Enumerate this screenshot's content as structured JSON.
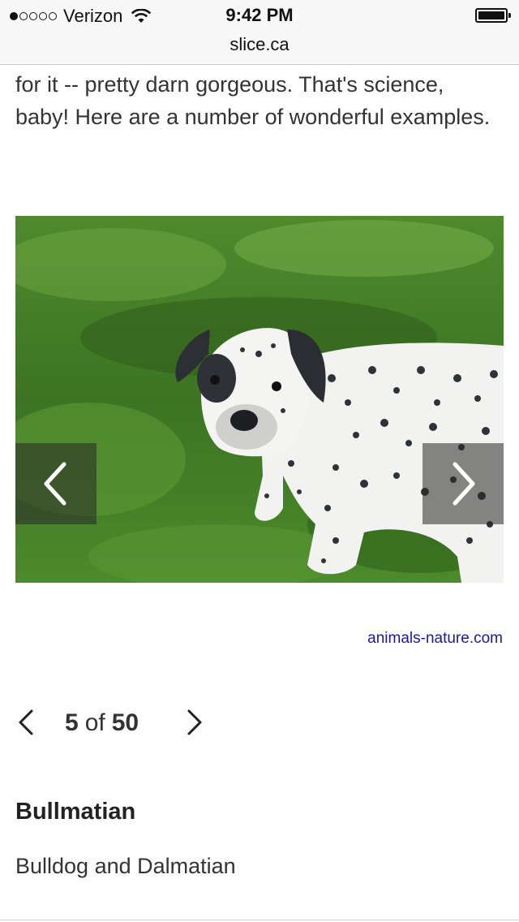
{
  "status_bar": {
    "carrier": "Verizon",
    "time": "9:42 PM",
    "signal_bars": 1,
    "battery_level": 1.0
  },
  "browser": {
    "url": "slice.ca"
  },
  "article": {
    "intro_text": "for it -- pretty darn gorgeous. That's science, baby! Here are a number of wonderful examples."
  },
  "gallery": {
    "image_icon": "spotted-puppy-photo",
    "prev_icon": "chevron-left-icon",
    "next_icon": "chevron-right-icon",
    "credit": "animals-nature.com",
    "current": "5",
    "of_label": "of",
    "total": "50",
    "slide_title": "Bullmatian",
    "slide_caption": "Bulldog and Dalmatian"
  },
  "colors": {
    "link": "#1a1a9c",
    "text": "#333333",
    "grass": "#3f7a22"
  }
}
